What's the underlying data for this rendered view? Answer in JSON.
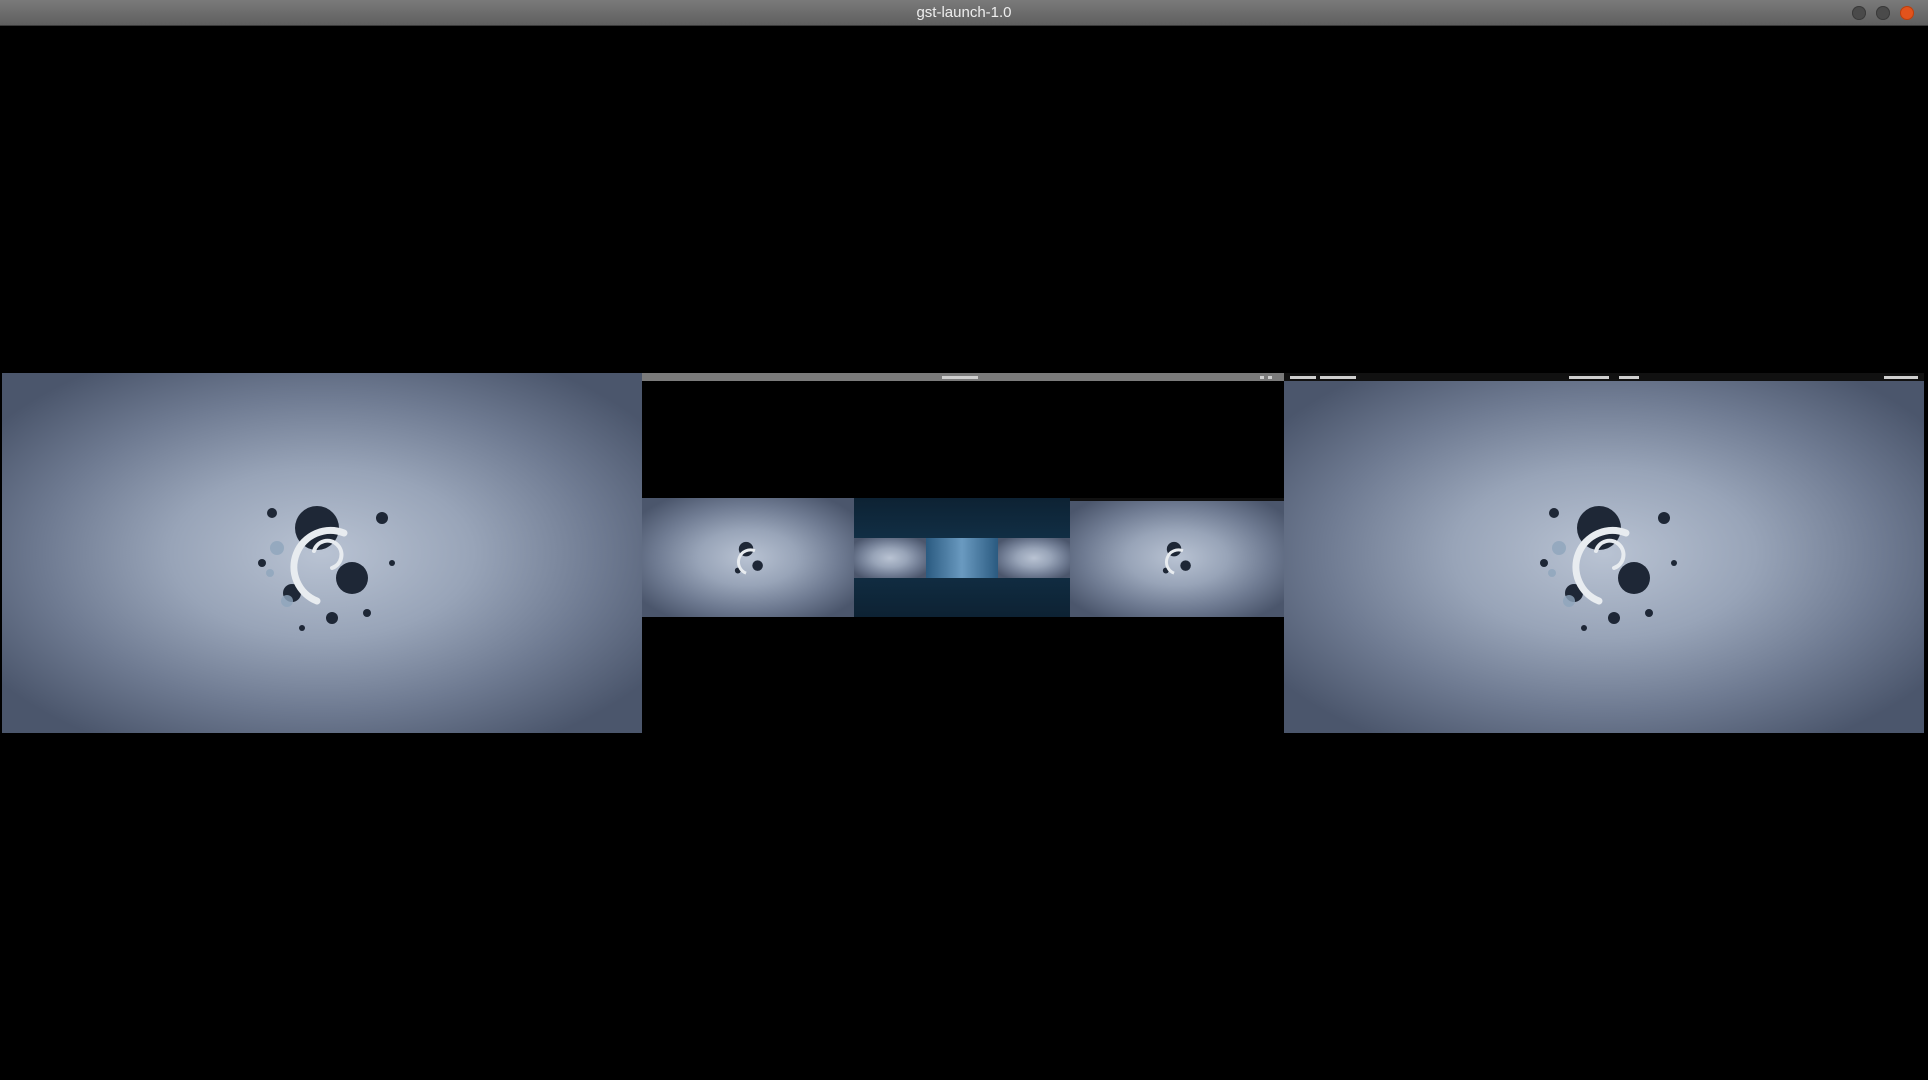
{
  "window": {
    "title": "gst-launch-1.0",
    "controls": [
      "minimize",
      "maximize",
      "close"
    ],
    "close_color": "#e2531c"
  },
  "content": {
    "description_icon": "debian-swirl-icon",
    "accent_background": "#98a4b8"
  }
}
